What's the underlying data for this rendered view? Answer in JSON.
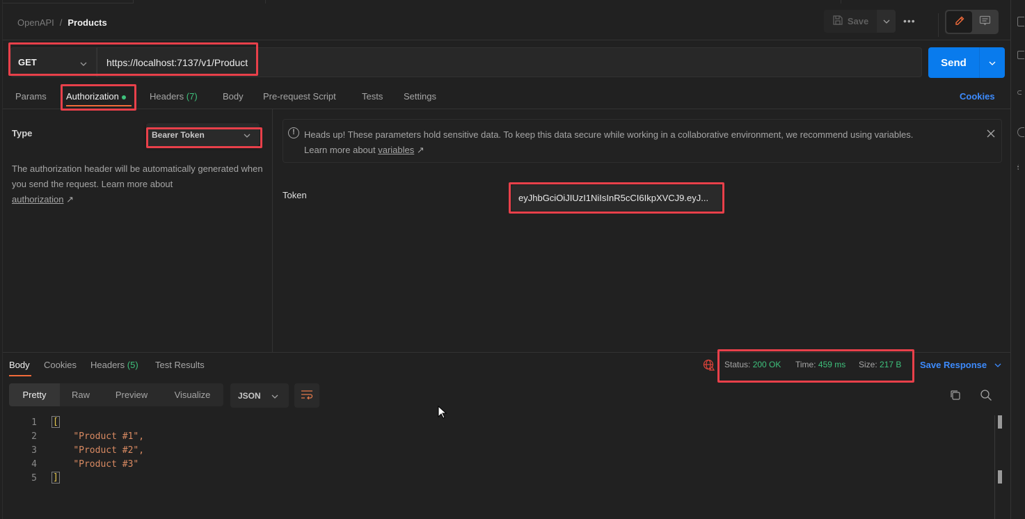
{
  "breadcrumb": {
    "parent": "OpenAPI",
    "separator": "/",
    "current": "Products"
  },
  "header": {
    "save_label": "Save",
    "more_label": "•••",
    "icons": {
      "save": "floppy-disk-icon",
      "dropdown": "chevron-down-icon",
      "edit": "pencil-icon",
      "comment": "comment-icon"
    }
  },
  "request": {
    "method": "GET",
    "url": "https://localhost:7137/v1/Product",
    "send_label": "Send"
  },
  "request_tabs": [
    {
      "label": "Params"
    },
    {
      "label": "Authorization",
      "active": true,
      "indicator": "green-dot"
    },
    {
      "label": "Headers",
      "count": "(7)"
    },
    {
      "label": "Body"
    },
    {
      "label": "Pre-request Script"
    },
    {
      "label": "Tests"
    },
    {
      "label": "Settings"
    }
  ],
  "cookies_link": "Cookies",
  "auth": {
    "type_label": "Type",
    "type_value": "Bearer Token",
    "help_text": "The authorization header will be automatically generated when you send the request. Learn more about ",
    "help_link": "authorization",
    "help_link_arrow": "↗",
    "notice_text": "Heads up! These parameters hold sensitive data. To keep this data secure while working in a collaborative environment, we recommend using variables.",
    "notice_learn": "Learn more about ",
    "notice_link": "variables",
    "notice_arrow": "↗",
    "token_label": "Token",
    "token_value": "eyJhbGciOiJIUzI1NiIsInR5cCI6IkpXVCJ9.eyJ..."
  },
  "response_tabs": [
    {
      "label": "Body",
      "active": true
    },
    {
      "label": "Cookies"
    },
    {
      "label": "Headers",
      "count": "(5)"
    },
    {
      "label": "Test Results"
    }
  ],
  "response_status": {
    "status_label": "Status:",
    "status_value": "200 OK",
    "time_label": "Time:",
    "time_value": "459 ms",
    "size_label": "Size:",
    "size_value": "217 B"
  },
  "save_response_label": "Save Response",
  "view_options": [
    {
      "label": "Pretty",
      "active": true
    },
    {
      "label": "Raw"
    },
    {
      "label": "Preview"
    },
    {
      "label": "Visualize"
    }
  ],
  "format": "JSON",
  "response_body": [
    {
      "line": "1",
      "text": "["
    },
    {
      "line": "2",
      "text": "\"Product #1\","
    },
    {
      "line": "3",
      "text": "\"Product #2\","
    },
    {
      "line": "4",
      "text": "\"Product #3\""
    },
    {
      "line": "5",
      "text": "]"
    }
  ],
  "colors": {
    "accent_blue": "#097bed",
    "link_blue": "#3d8bfd",
    "success_green": "#3ec17c",
    "tab_underline": "#f26b3a",
    "highlight_red": "#e8404a",
    "string_orange": "#d98a62"
  }
}
